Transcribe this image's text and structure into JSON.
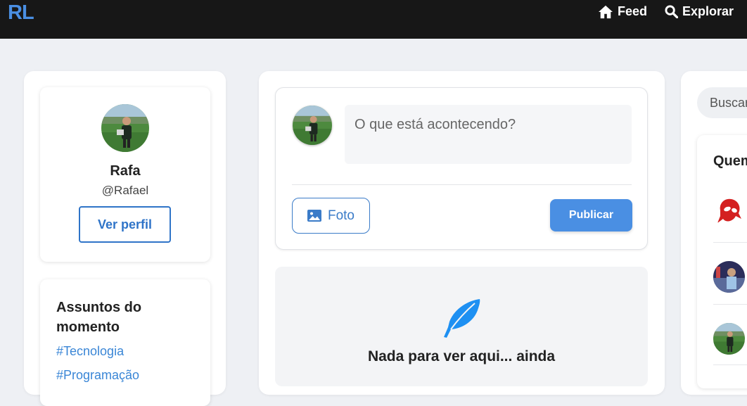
{
  "header": {
    "logo": "RL",
    "nav": [
      {
        "label": "Feed",
        "icon": "home-icon"
      },
      {
        "label": "Explorar",
        "icon": "search-icon"
      }
    ]
  },
  "profile": {
    "name": "Rafa",
    "handle": "@Rafael",
    "view_profile_label": "Ver perfil"
  },
  "trends": {
    "title": "Assuntos do momento",
    "items": [
      "#Tecnologia",
      "#Programação"
    ]
  },
  "composer": {
    "placeholder": "O que está acontecendo?",
    "photo_label": "Foto",
    "publish_label": "Publicar"
  },
  "feed_empty": {
    "title": "Nada para ver aqui... ainda",
    "subtitle": ""
  },
  "right_sidebar": {
    "search_placeholder": "Buscar",
    "who_to_follow_title": "Quem"
  },
  "colors": {
    "accent": "#4a8fe3",
    "topbar": "#171717",
    "background": "#eef0f4"
  }
}
